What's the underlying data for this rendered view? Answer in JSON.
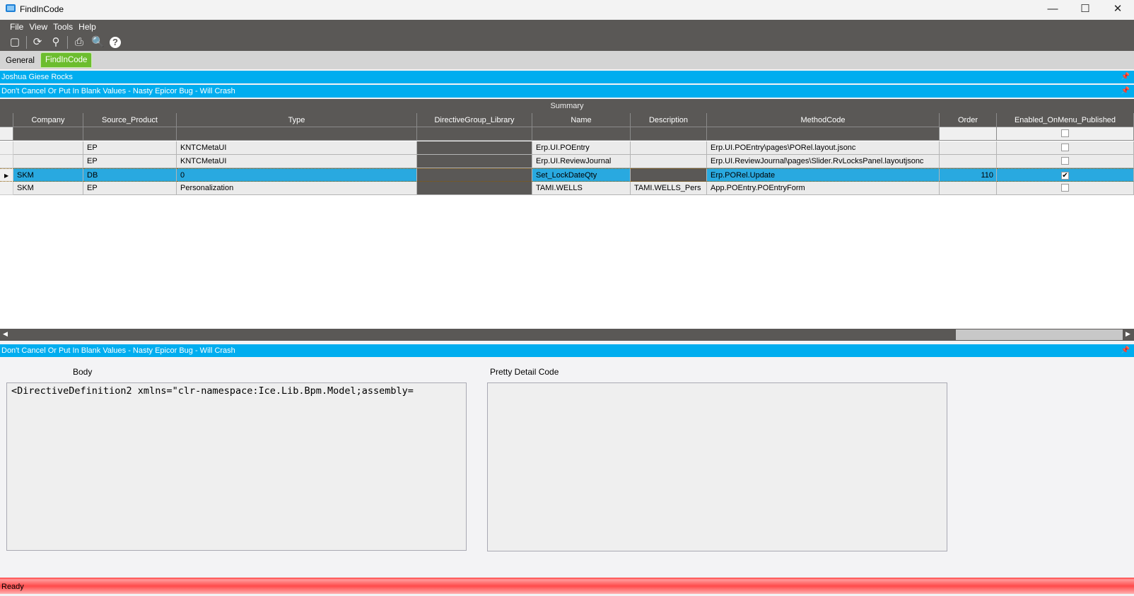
{
  "window": {
    "title": "FindInCode",
    "minimize": "—",
    "maximize": "☐",
    "close": "✕"
  },
  "menu": [
    "File",
    "View",
    "Tools",
    "Help"
  ],
  "toolbar": {
    "icons": [
      "new-icon",
      "refresh-icon",
      "clear-icon",
      "print-icon",
      "print-preview-icon",
      "help-icon"
    ]
  },
  "tabs": [
    {
      "label": "General"
    },
    {
      "label": "FindInCode"
    }
  ],
  "banners": {
    "top1": "Joshua Giese Rocks",
    "top2": "Don't Cancel Or Put In Blank Values - Nasty Epicor Bug - Will Crash",
    "bottom": "Don't Cancel Or Put In Blank Values - Nasty Epicor Bug - Will Crash"
  },
  "grid": {
    "caption": "Summary",
    "columns": [
      "Company",
      "Source_Product",
      "Type",
      "DirectiveGroup_Library",
      "Name",
      "Description",
      "MethodCode",
      "Order",
      "Enabled_OnMenu_Published"
    ],
    "rows": [
      {
        "Company": "",
        "Source_Product": "EP",
        "Type": "KNTCMetaUI",
        "DirectiveGroup_Library": "",
        "Name": "Erp.UI.POEntry",
        "Description": "",
        "MethodCode": "Erp.UI.POEntry\\pages\\PORel.layout.jsonc",
        "Order": "",
        "Enabled": false
      },
      {
        "Company": "",
        "Source_Product": "EP",
        "Type": "KNTCMetaUI",
        "DirectiveGroup_Library": "",
        "Name": "Erp.UI.ReviewJournal",
        "Description": "",
        "MethodCode": "Erp.UI.ReviewJournal\\pages\\Slider.RvLocksPanel.layoutjsonc",
        "Order": "",
        "Enabled": false
      },
      {
        "Company": "SKM",
        "Source_Product": "DB",
        "Type": "0",
        "DirectiveGroup_Library": "",
        "Name": "Set_LockDateQty",
        "Description": "",
        "MethodCode": "Erp.PORel.Update",
        "Order": "110",
        "Enabled": true
      },
      {
        "Company": "SKM",
        "Source_Product": "EP",
        "Type": "Personalization",
        "DirectiveGroup_Library": "",
        "Name": "TAMI.WELLS",
        "Description": "TAMI.WELLS_Pers",
        "MethodCode": "App.POEntry.POEntryForm",
        "Order": "",
        "Enabled": false
      }
    ]
  },
  "detail": {
    "body_label": "Body",
    "body_text": "<DirectiveDefinition2 xmlns=\"clr-namespace:Ice.Lib.Bpm.Model;assembly=",
    "pretty_label": "Pretty Detail Code",
    "pretty_text": ""
  },
  "status": "Ready"
}
